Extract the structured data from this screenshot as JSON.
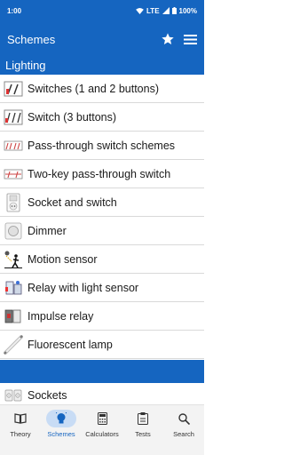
{
  "status": {
    "time": "1:00",
    "network": "LTE",
    "battery": "100%"
  },
  "appbar": {
    "title": "Schemes",
    "icons": [
      "star-icon",
      "menu-icon"
    ]
  },
  "section": {
    "title": "Lighting"
  },
  "items": [
    {
      "label": "Switches (1 and 2 buttons)",
      "icon": "switch-scheme-icon"
    },
    {
      "label": "Switch (3 buttons)",
      "icon": "switch-scheme-icon"
    },
    {
      "label": "Pass-through switch schemes",
      "icon": "pass-through-icon"
    },
    {
      "label": "Two-key pass-through switch",
      "icon": "pass-through-icon"
    },
    {
      "label": "Socket and switch",
      "icon": "socket-icon"
    },
    {
      "label": "Dimmer",
      "icon": "dimmer-icon"
    },
    {
      "label": "Motion sensor",
      "icon": "motion-sensor-icon"
    },
    {
      "label": "Relay with light sensor",
      "icon": "relay-icon"
    },
    {
      "label": "Impulse relay",
      "icon": "impulse-relay-icon"
    },
    {
      "label": "Fluorescent lamp",
      "icon": "fluorescent-lamp-icon"
    }
  ],
  "next_item": {
    "label": "Sockets",
    "icon": "sockets-icon"
  },
  "nav": [
    {
      "label": "Theory",
      "icon": "book-icon",
      "active": false
    },
    {
      "label": "Schemes",
      "icon": "bulb-icon",
      "active": true
    },
    {
      "label": "Calculators",
      "icon": "calculator-icon",
      "active": false
    },
    {
      "label": "Tests",
      "icon": "tests-icon",
      "active": false
    },
    {
      "label": "Search",
      "icon": "search-icon",
      "active": false
    }
  ],
  "colors": {
    "primary": "#1565c0",
    "nav_active_bg": "#c8dcf5"
  }
}
